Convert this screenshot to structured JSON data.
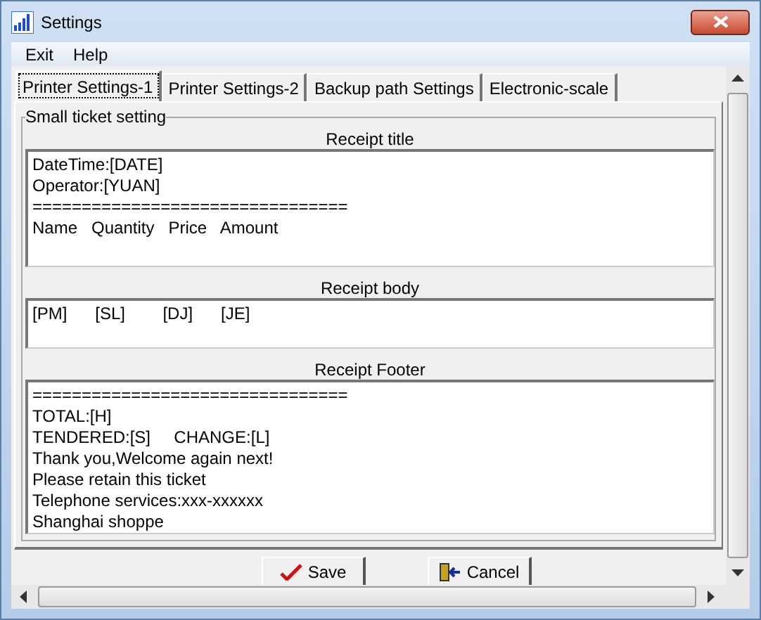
{
  "window": {
    "title": "Settings"
  },
  "menu": [
    "Exit",
    "Help"
  ],
  "tabs": [
    {
      "label": "Printer Settings-1",
      "selected": true
    },
    {
      "label": "Printer Settings-2",
      "selected": false
    },
    {
      "label": "Backup path Settings",
      "selected": false
    },
    {
      "label": "Electronic-scale",
      "selected": false
    }
  ],
  "group": {
    "title": "Small ticket setting",
    "fields": [
      {
        "label": "Receipt title",
        "value": "DateTime:[DATE]\nOperator:[YUAN]\n================================\nName   Quantity   Price   Amount"
      },
      {
        "label": "Receipt body",
        "value": "[PM]      [SL]        [DJ]      [JE]"
      },
      {
        "label": "Receipt Footer",
        "value": "================================\nTOTAL:[H]\nTENDERED:[S]     CHANGE:[L]\nThank you,Welcome again next!\nPlease retain this ticket\nTelephone services:xxx-xxxxxx\nShanghai shoppe"
      }
    ]
  },
  "buttons": [
    {
      "label": "Save",
      "kind": "save"
    },
    {
      "label": "Cancel",
      "kind": "cancel"
    }
  ]
}
